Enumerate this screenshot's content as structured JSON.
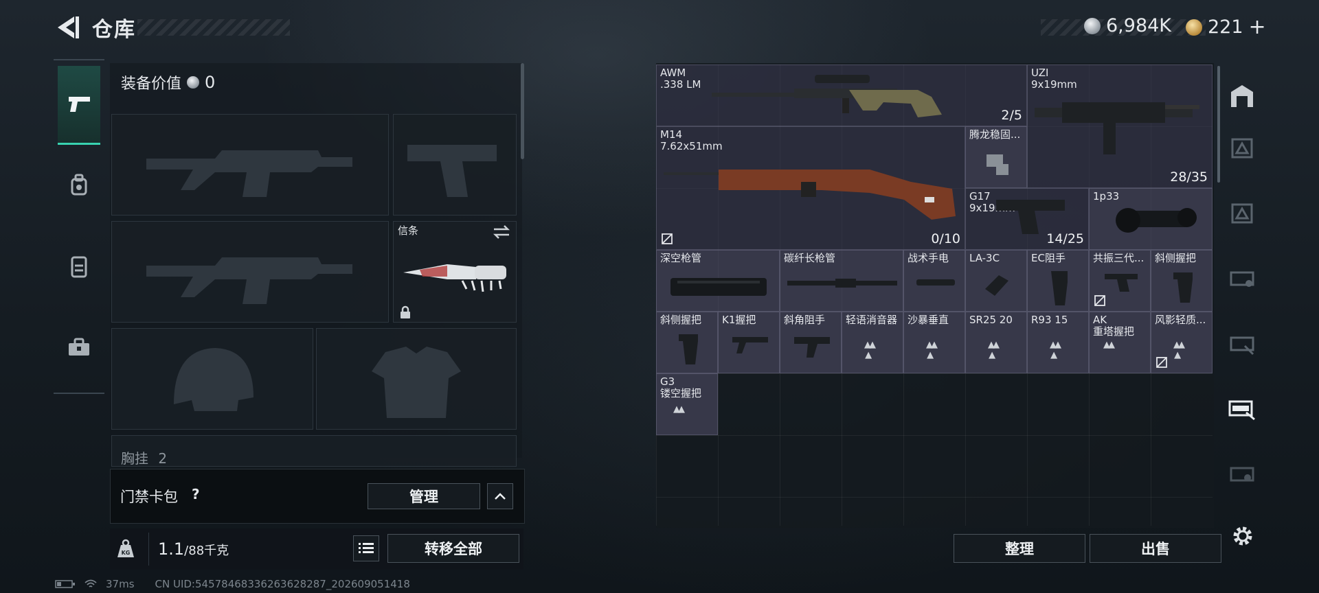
{
  "header": {
    "title": "仓库"
  },
  "currency": {
    "silver": "6,984K",
    "gold": "221",
    "add": "+"
  },
  "loadout": {
    "equip_value_label": "装备价值",
    "equip_value": "0",
    "melee_label": "信条",
    "chest_label": "胸挂",
    "chest_count": "2"
  },
  "keycard": {
    "label": "门禁卡包",
    "help": "?",
    "manage": "管理"
  },
  "weight": {
    "current": "1.1",
    "max_unit": "/88千克",
    "transfer_all": "转移全部"
  },
  "inventory": {
    "items": [
      {
        "name": "AWM",
        "sub": ".338 LM",
        "count": "2/5"
      },
      {
        "name": "UZI",
        "sub": "9x19mm",
        "count": "28/35"
      },
      {
        "name": "M14",
        "sub": "7.62x51mm",
        "count": "0/10"
      },
      {
        "name": "腾龙稳固...",
        "sub": "",
        "count": ""
      },
      {
        "name": "G17",
        "sub": "9x19mm",
        "count": "14/25"
      },
      {
        "name": "1p33",
        "sub": "",
        "count": ""
      },
      {
        "name": "深空枪管"
      },
      {
        "name": "碳纤长枪管"
      },
      {
        "name": "战术手电"
      },
      {
        "name": "LA-3C"
      },
      {
        "name": "EC阻手"
      },
      {
        "name": "共振三代..."
      },
      {
        "name": "斜侧握把"
      },
      {
        "name": "斜侧握把"
      },
      {
        "name": "K1握把"
      },
      {
        "name": "斜角阻手"
      },
      {
        "name": "轻语消音器"
      },
      {
        "name": "沙暴垂直"
      },
      {
        "name": "SR25 20"
      },
      {
        "name": "R93 15"
      },
      {
        "name": "AK",
        "sub": "重塔握把"
      },
      {
        "name": "风影轻质..."
      },
      {
        "name": "G3",
        "sub": "镂空握把"
      }
    ],
    "sort_label": "整理",
    "sell_label": "出售"
  },
  "status": {
    "ping": "37ms",
    "uid": "CN UID:545784683362636282​87_202609051418"
  }
}
